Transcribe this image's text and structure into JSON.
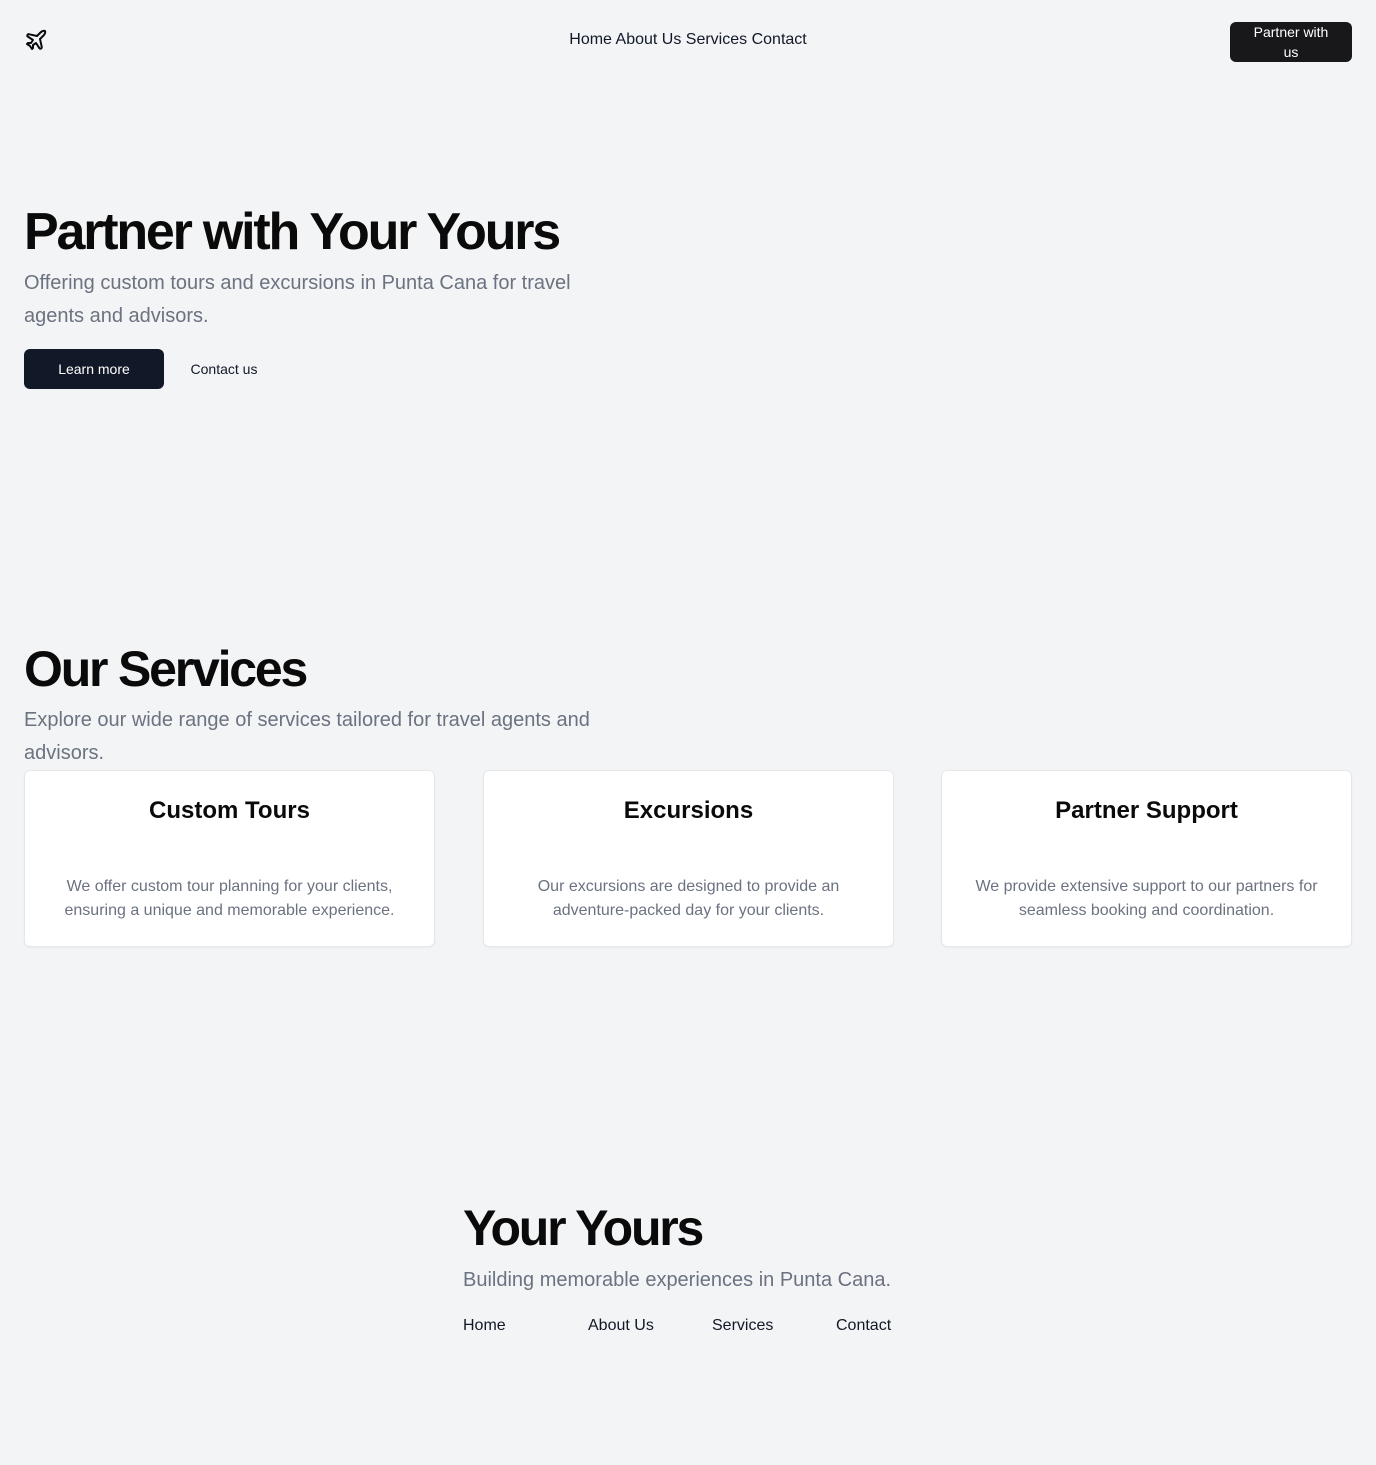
{
  "header": {
    "logo_icon": "plane-icon",
    "nav": [
      "Home",
      "About Us",
      "Services",
      "Contact"
    ],
    "cta_label": "Partner with us"
  },
  "hero": {
    "title": "Partner with Your Yours",
    "subtitle": "Offering custom tours and excursions in Punta Cana for travel agents and advisors.",
    "primary_label": "Learn more",
    "secondary_label": "Contact us"
  },
  "services": {
    "title": "Our Services",
    "subtitle": "Explore our wide range of services tailored for travel agents and advisors.",
    "cards": [
      {
        "title": "Custom Tours",
        "text": "We offer custom tour planning for your clients, ensuring a unique and memorable experience."
      },
      {
        "title": "Excursions",
        "text": "Our excursions are designed to provide an adventure-packed day for your clients."
      },
      {
        "title": "Partner Support",
        "text": "We provide extensive support to our partners for seamless booking and coordination."
      }
    ]
  },
  "footer": {
    "title": "Your Yours",
    "subtitle": "Building memorable experiences in Punta Cana.",
    "nav": [
      "Home",
      "About Us",
      "Services",
      "Contact"
    ]
  },
  "colors": {
    "background": "#f3f4f6",
    "primary_button": "#111827",
    "header_button": "#18181b",
    "muted_text": "#6b7280"
  }
}
